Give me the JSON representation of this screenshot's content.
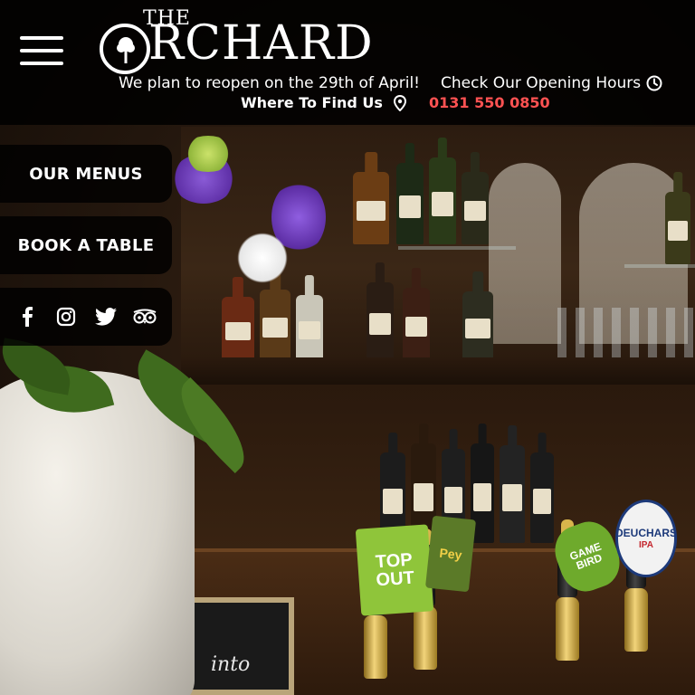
{
  "header": {
    "logo": {
      "the": "THE",
      "o": "O",
      "rchard": "RCHARD"
    },
    "reopen_text": "We plan to reopen on the 29th of April!",
    "hours_link": "Check Our Opening Hours",
    "find_link": "Where To Find Us",
    "phone": "0131 550 0850",
    "phone_color": "#ff5252"
  },
  "side_nav": {
    "menus_label": "OUR MENUS",
    "book_label": "BOOK A TABLE"
  },
  "social": [
    "facebook-icon",
    "instagram-icon",
    "twitter-icon",
    "tripadvisor-icon"
  ],
  "pump_clips": {
    "clip1": "TOP OUT",
    "clip2": "Pey",
    "clip3": "GAME BIRD",
    "clip4": "DEUCHARS",
    "clip4_sub": "IPA"
  },
  "chalkboard": "into"
}
